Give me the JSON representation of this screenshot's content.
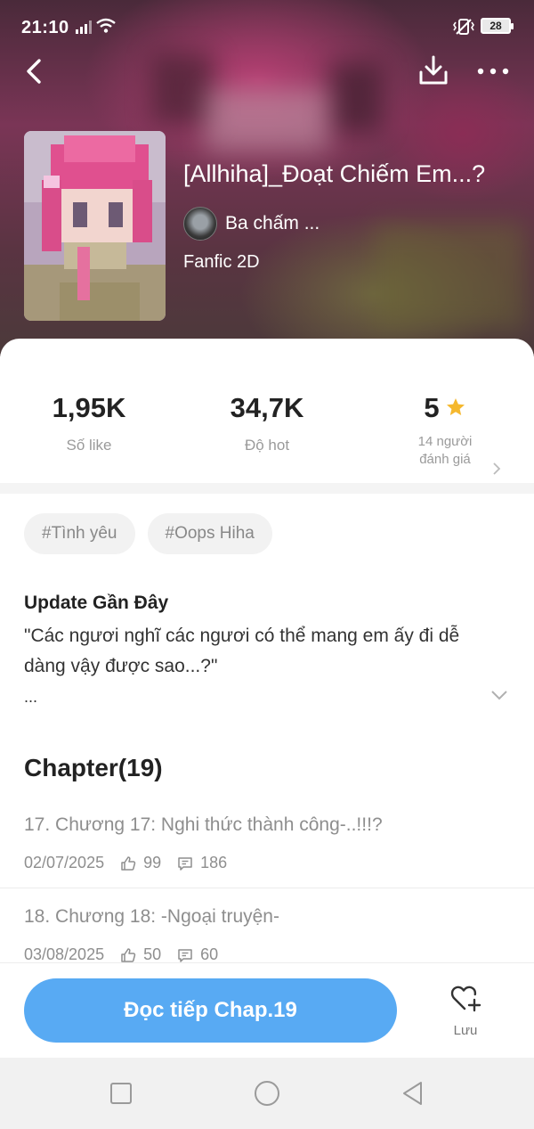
{
  "status_bar": {
    "time": "21:10",
    "battery": "28"
  },
  "story": {
    "title": "[Allhiha]_Đoạt Chiếm Em...?",
    "author": "Ba chấm ...",
    "genre": "Fanfic 2D"
  },
  "stats": {
    "likes_value": "1,95K",
    "likes_label": "Số like",
    "hot_value": "34,7K",
    "hot_label": "Độ hot",
    "rating_value": "5",
    "rating_label_line1": "14 người",
    "rating_label_line2": "đánh giá",
    "star_color": "#f5b82e"
  },
  "tags": [
    "#Tình yêu",
    "#Oops Hiha"
  ],
  "update": {
    "heading": "Update Gần Đây",
    "text": "\"Các ngươi nghĩ các ngươi có thể mang em ấy đi dễ dàng vậy được sao...?\"",
    "ellipsis": "..."
  },
  "chapters": {
    "heading": "Chapter(19)",
    "items": [
      {
        "title": "17. Chương 17: Nghi thức thành công-..!!!?",
        "date": "02/07/2025",
        "likes": "99",
        "comments": "186"
      },
      {
        "title": "18. Chương 18: -Ngoại truyện-",
        "date": "03/08/2025",
        "likes": "50",
        "comments": "60"
      }
    ]
  },
  "bottom_bar": {
    "read_label": "Đọc tiếp Chap.19",
    "save_label": "Lưu",
    "accent": "#58aaf3"
  }
}
